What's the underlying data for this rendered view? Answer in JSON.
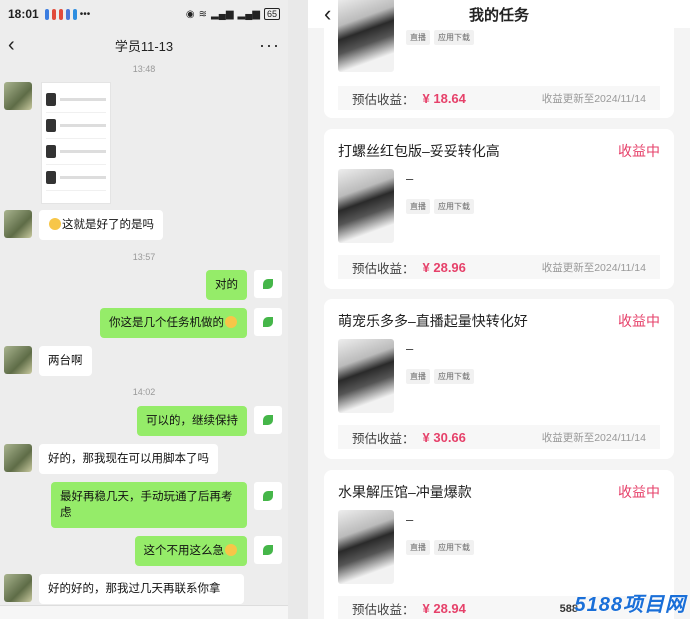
{
  "status_bar": {
    "time": "18:01",
    "battery": "65"
  },
  "chat": {
    "title": "学员11-13",
    "messages": [
      {
        "time": "13:48"
      },
      {
        "text": "这就是好了的是吗"
      },
      {
        "time": "13:57"
      },
      {
        "text": "对的"
      },
      {
        "text": "你这是几个任务机做的"
      },
      {
        "text": "两台啊"
      },
      {
        "time": "14:02"
      },
      {
        "text": "可以的，继续保持"
      },
      {
        "text": "好的，那我现在可以用脚本了吗"
      },
      {
        "text": "最好再稳几天，手动玩通了后再考虑"
      },
      {
        "text": "这个不用这么急"
      },
      {
        "text": "好的好的，那我过几天再联系你拿"
      }
    ]
  },
  "tasks": {
    "title": "我的任务",
    "tags": [
      "直播",
      "应用下载"
    ],
    "earn_label": "预估收益：",
    "cards": [
      {
        "name": "",
        "state": "",
        "subtitle": "",
        "amount": "¥ 18.64",
        "updated": "收益更新至2024/11/14"
      },
      {
        "name": "打螺丝红包版–妥妥转化高",
        "state": "收益中",
        "subtitle": "–",
        "amount": "¥ 28.96",
        "updated": "收益更新至2024/11/14"
      },
      {
        "name": "萌宠乐多多–直播起量快转化好",
        "state": "收益中",
        "subtitle": "–",
        "amount": "¥ 30.66",
        "updated": "收益更新至2024/11/14"
      },
      {
        "name": "水果解压馆–冲量爆款",
        "state": "收益中",
        "subtitle": "–",
        "amount": "¥ 28.94",
        "updated": ""
      }
    ]
  },
  "watermark": {
    "text": "5188项目网",
    "small": "588"
  }
}
